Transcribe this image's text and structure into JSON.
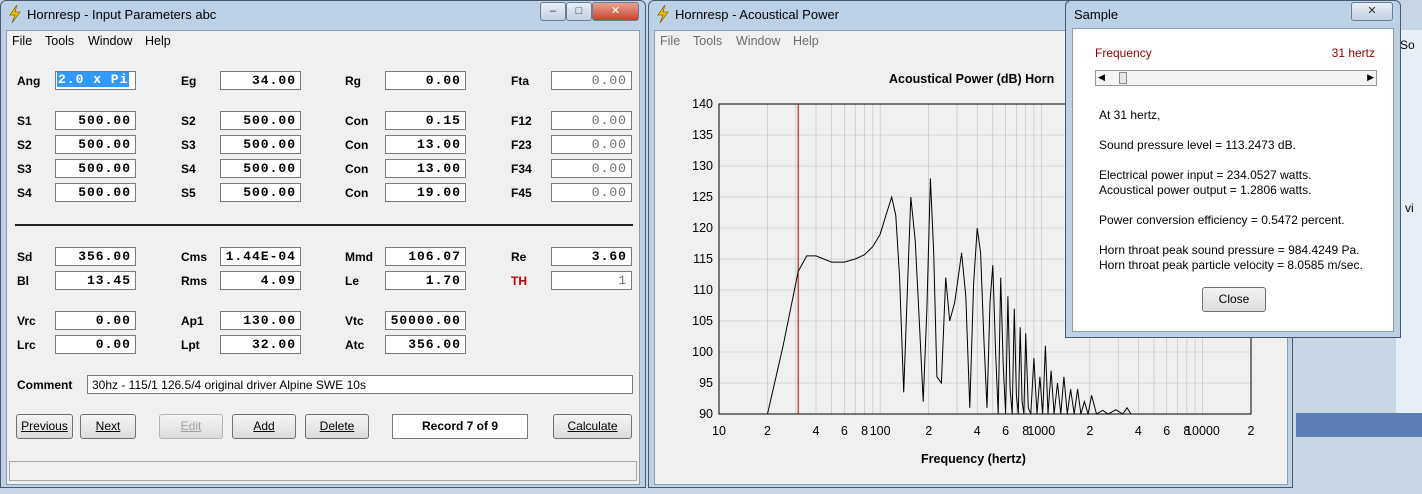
{
  "input_window": {
    "title": "Hornresp - Input Parameters   abc",
    "menu": [
      "File",
      "Tools",
      "Window",
      "Help"
    ],
    "rows": [
      [
        {
          "label": "Ang",
          "value": "2.0 x Pi",
          "selected": true
        },
        {
          "label": "Eg",
          "value": "34.00"
        },
        {
          "label": "Rg",
          "value": "0.00"
        },
        {
          "label": "Fta",
          "value": "0.00",
          "disabled": true
        }
      ],
      [
        {
          "label": "S1",
          "value": "500.00"
        },
        {
          "label": "S2",
          "value": "500.00"
        },
        {
          "label": "Con",
          "value": "0.15"
        },
        {
          "label": "F12",
          "value": "0.00",
          "disabled": true
        }
      ],
      [
        {
          "label": "S2",
          "value": "500.00"
        },
        {
          "label": "S3",
          "value": "500.00"
        },
        {
          "label": "Con",
          "value": "13.00"
        },
        {
          "label": "F23",
          "value": "0.00",
          "disabled": true
        }
      ],
      [
        {
          "label": "S3",
          "value": "500.00"
        },
        {
          "label": "S4",
          "value": "500.00"
        },
        {
          "label": "Con",
          "value": "13.00"
        },
        {
          "label": "F34",
          "value": "0.00",
          "disabled": true
        }
      ],
      [
        {
          "label": "S4",
          "value": "500.00"
        },
        {
          "label": "S5",
          "value": "500.00"
        },
        {
          "label": "Con",
          "value": "19.00"
        },
        {
          "label": "F45",
          "value": "0.00",
          "disabled": true
        }
      ],
      [
        {
          "label": "Sd",
          "value": "356.00"
        },
        {
          "label": "Cms",
          "value": "1.44E-04"
        },
        {
          "label": "Mmd",
          "value": "106.07"
        },
        {
          "label": "Re",
          "value": "3.60"
        }
      ],
      [
        {
          "label": "Bl",
          "value": "13.45"
        },
        {
          "label": "Rms",
          "value": "4.09"
        },
        {
          "label": "Le",
          "value": "1.70"
        },
        {
          "label": "TH",
          "value": "1",
          "red": true,
          "disabled": true
        }
      ],
      [
        {
          "label": "Vrc",
          "value": "0.00"
        },
        {
          "label": "Ap1",
          "value": "130.00"
        },
        {
          "label": "Vtc",
          "value": "50000.00"
        }
      ],
      [
        {
          "label": "Lrc",
          "value": "0.00"
        },
        {
          "label": "Lpt",
          "value": "32.00"
        },
        {
          "label": "Atc",
          "value": "356.00"
        }
      ]
    ],
    "comment_label": "Comment",
    "comment": "30hz - 115/1 126.5/4 original driver Alpine SWE 10s",
    "buttons": {
      "previous": "Previous",
      "next": "Next",
      "edit": "Edit",
      "add": "Add",
      "delete": "Delete",
      "calculate": "Calculate"
    },
    "record": "Record 7 of 9"
  },
  "power_window": {
    "title": "Hornresp - Acoustical Power",
    "menu": [
      "File",
      "Tools",
      "Window",
      "Help"
    ],
    "chart_title": "Acoustical Power (dB)   Horn",
    "xlabel": "Frequency (hertz)"
  },
  "sample_dialog": {
    "title": "Sample",
    "frequency_label": "Frequency",
    "frequency_value": "31 hertz",
    "lines": [
      "At 31 hertz,",
      "Sound pressure level = 113.2473 dB.",
      "Electrical power input = 234.0527 watts.",
      "Acoustical power output = 1.2806 watts.",
      "Power conversion efficiency = 0.5472 percent.",
      "Horn throat peak sound pressure = 984.4249 Pa.",
      "Horn throat peak particle velocity = 8.0585 m/sec."
    ],
    "close_label": "Close"
  },
  "background_text": {
    "so": "So",
    "vi": "vi"
  },
  "chart_data": {
    "type": "line",
    "title": "Acoustical Power (dB)   Horn",
    "xlabel": "Frequency (hertz)",
    "ylabel": "",
    "x_scale": "log",
    "xlim": [
      10,
      20000
    ],
    "ylim": [
      90,
      140
    ],
    "yticks": [
      90,
      95,
      100,
      105,
      110,
      115,
      120,
      125,
      130,
      135,
      140
    ],
    "xtick_labels": [
      "10",
      "2",
      "4",
      "6",
      "8",
      "100",
      "2",
      "4",
      "6",
      "8",
      "1000",
      "2",
      "4",
      "6",
      "8",
      "10000",
      "2"
    ],
    "xtick_values": [
      10,
      20,
      40,
      60,
      80,
      100,
      200,
      400,
      600,
      800,
      1000,
      2000,
      4000,
      6000,
      8000,
      10000,
      20000
    ],
    "grid": true,
    "marker_frequency": 31,
    "series": [
      {
        "x": [
          20,
          25,
          31,
          35,
          40,
          50,
          60,
          70,
          80,
          90,
          100,
          110,
          118,
          125,
          132,
          140,
          148,
          155,
          165,
          175,
          185,
          195,
          205,
          215,
          225,
          240,
          255,
          270,
          290,
          305,
          320,
          340,
          360,
          380,
          400,
          420,
          440,
          460,
          480,
          500,
          520,
          540,
          560,
          580,
          600,
          620,
          640,
          660,
          680,
          700,
          720,
          740,
          760,
          780,
          800,
          830,
          860,
          900,
          940,
          980,
          1020,
          1060,
          1100,
          1150,
          1200,
          1260,
          1320,
          1380,
          1450,
          1520,
          1600,
          1680,
          1760,
          1850,
          1950,
          2050,
          2200,
          2400,
          2600,
          2900,
          3200,
          3400,
          3600,
          4000
        ],
        "y": [
          90,
          101,
          113,
          115.5,
          115.5,
          114.5,
          114.5,
          115,
          115.7,
          117,
          119,
          122.5,
          125,
          122,
          112,
          93.5,
          111,
          125,
          118,
          105,
          92,
          107,
          128,
          116,
          96,
          95,
          112,
          105,
          108,
          112,
          116,
          109,
          91,
          111,
          120,
          116,
          102,
          91,
          108,
          114,
          100,
          90,
          112,
          98,
          90,
          109,
          94,
          90,
          107,
          93,
          90,
          104,
          92,
          90,
          103,
          91,
          90,
          99,
          90,
          96,
          90,
          101,
          90,
          97,
          90,
          95,
          90,
          96,
          90,
          94,
          90,
          94,
          90,
          92,
          90,
          93,
          90,
          90.6,
          90,
          90.7,
          90,
          91,
          90,
          90
        ]
      }
    ]
  }
}
